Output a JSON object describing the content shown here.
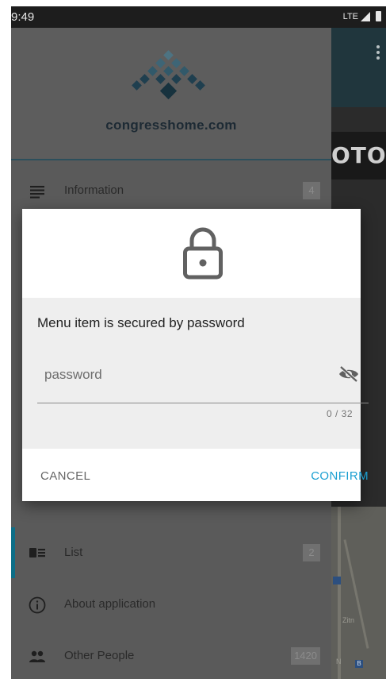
{
  "status_bar": {
    "time": "9:49",
    "network": "LTE"
  },
  "drawer": {
    "brand": "congresshome.com",
    "items": [
      {
        "label": "Information",
        "count": "4",
        "icon": "notes-icon"
      },
      {
        "label": "List",
        "count": "2",
        "icon": "list-card-icon"
      },
      {
        "label": "About application",
        "count": "",
        "icon": "info-circle-icon"
      },
      {
        "label": "Other People",
        "count": "1420",
        "icon": "people-icon"
      }
    ]
  },
  "background": {
    "banner_text": "OTO",
    "map_labels": [
      "Zitn",
      "N",
      "B"
    ]
  },
  "dialog": {
    "title": "Menu item is secured by password",
    "password": {
      "placeholder": "password",
      "value": "",
      "counter": "0 / 32"
    },
    "cancel_label": "CANCEL",
    "confirm_label": "CONFIRM"
  },
  "colors": {
    "accent": "#1a9fd1",
    "active_indicator": "#0d6e87",
    "brand_text": "#1d2a34"
  }
}
